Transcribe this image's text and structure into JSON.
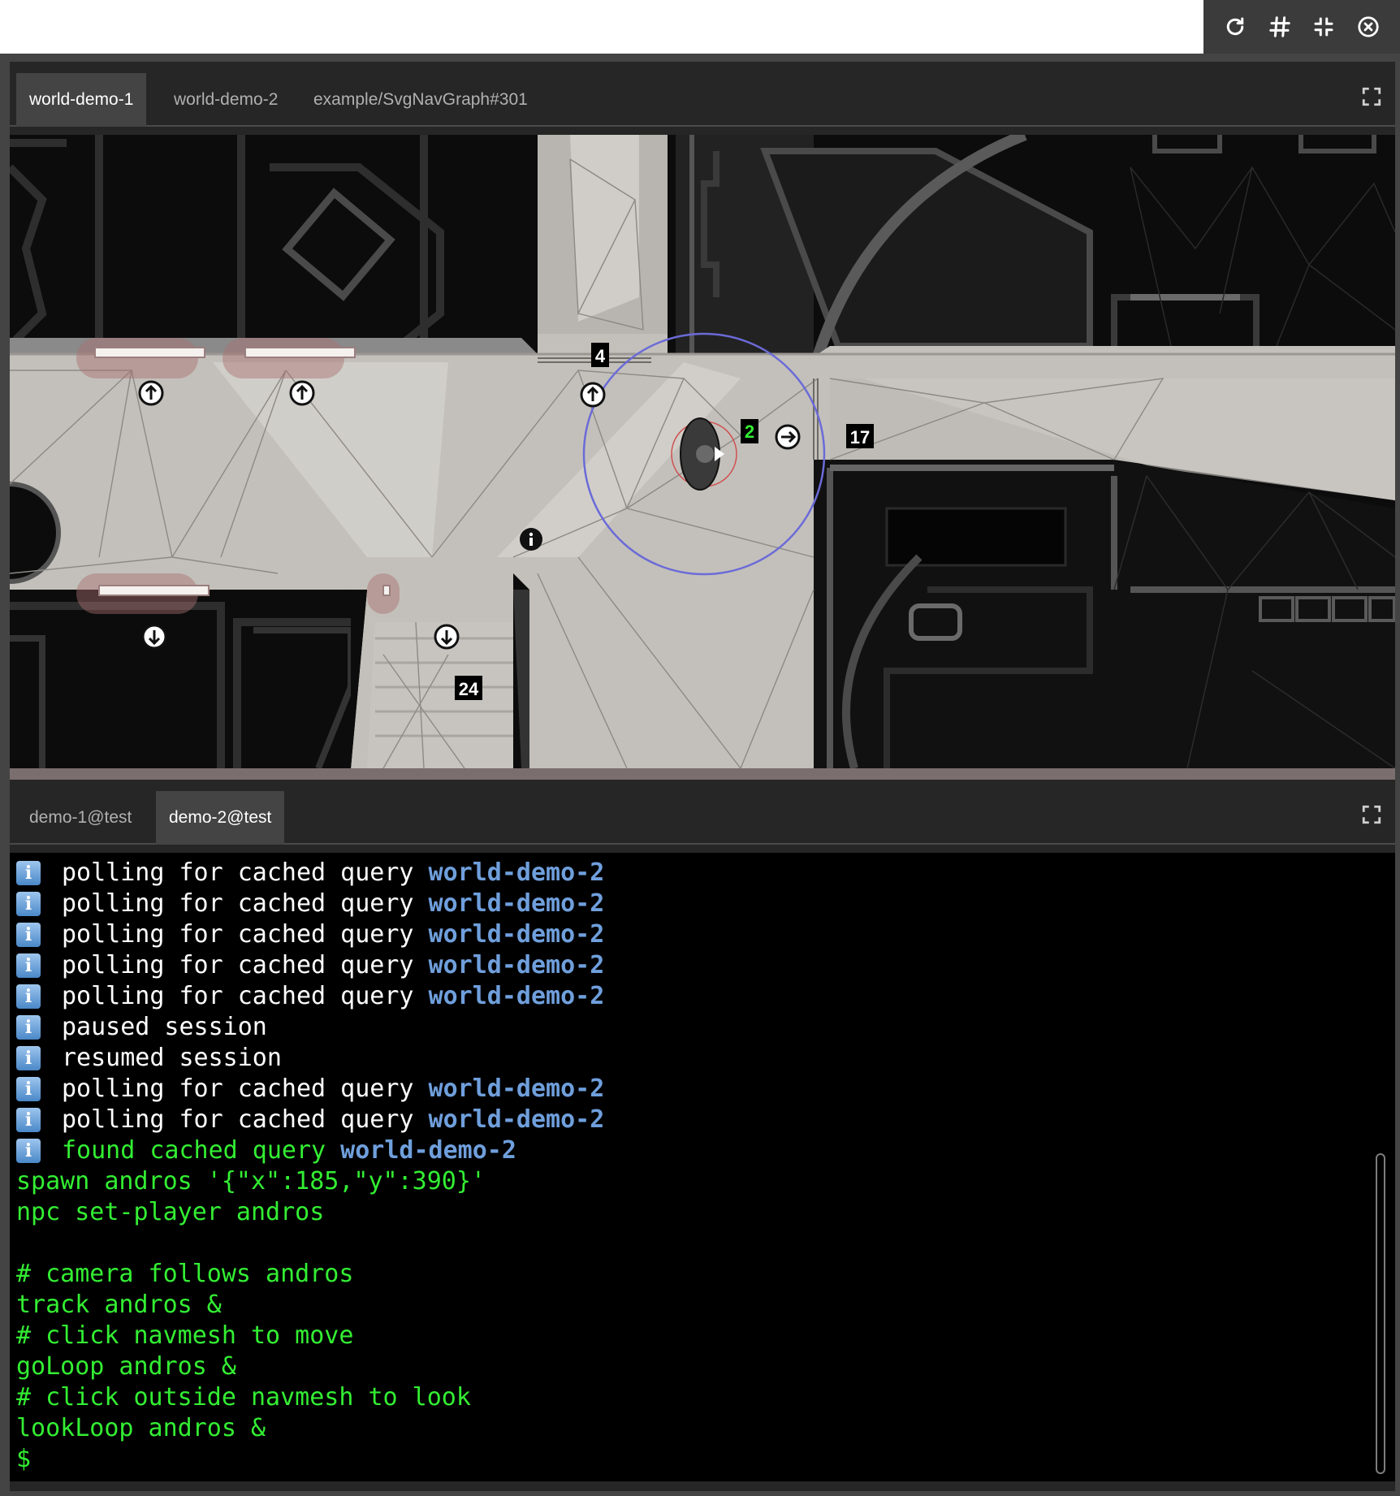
{
  "toolbar": {
    "buttons": [
      {
        "icon": "refresh-icon"
      },
      {
        "icon": "hash-icon"
      },
      {
        "icon": "collapse-icon"
      },
      {
        "icon": "close-circle-icon"
      }
    ]
  },
  "top_pane": {
    "tabs": [
      {
        "label": "world-demo-1",
        "active": true
      },
      {
        "label": "world-demo-2",
        "active": false
      },
      {
        "label": "example/SvgNavGraph#301",
        "active": false
      }
    ],
    "maximize_icon": "maximize-icon"
  },
  "map": {
    "labels": {
      "door_4": "4",
      "door_17": "17",
      "door_24": "24",
      "npc_2": "2"
    },
    "colors": {
      "floor": "#c2bfba",
      "walls": "#0f0f0f",
      "npc_label_bg": "#1fa31f",
      "range_circle": "#6b6bd8"
    }
  },
  "bottom_pane": {
    "tabs": [
      {
        "label": "demo-1@test",
        "active": false
      },
      {
        "label": "demo-2@test",
        "active": true
      }
    ],
    "maximize_icon": "maximize-icon"
  },
  "terminal": {
    "lines": [
      {
        "text": "polling for cached query ",
        "query": "world-demo-2"
      },
      {
        "text": "polling for cached query ",
        "query": "world-demo-2"
      },
      {
        "text": "polling for cached query ",
        "query": "world-demo-2"
      },
      {
        "text": "polling for cached query ",
        "query": "world-demo-2"
      },
      {
        "text": "polling for cached query ",
        "query": "world-demo-2"
      },
      {
        "text": "paused session"
      },
      {
        "text": "resumed session"
      },
      {
        "text": "polling for cached query ",
        "query": "world-demo-2"
      },
      {
        "text": "polling for cached query ",
        "query": "world-demo-2"
      },
      {
        "text": "found cached query ",
        "query": "world-demo-2"
      }
    ],
    "commands": [
      "spawn andros '{\"x\":185,\"y\":390}'",
      "npc set-player andros",
      "",
      "# camera follows andros",
      "track andros &",
      "# click navmesh to move",
      "goLoop andros &",
      "# click outside navmesh to look",
      "lookLoop andros &"
    ],
    "prompt": "$"
  }
}
